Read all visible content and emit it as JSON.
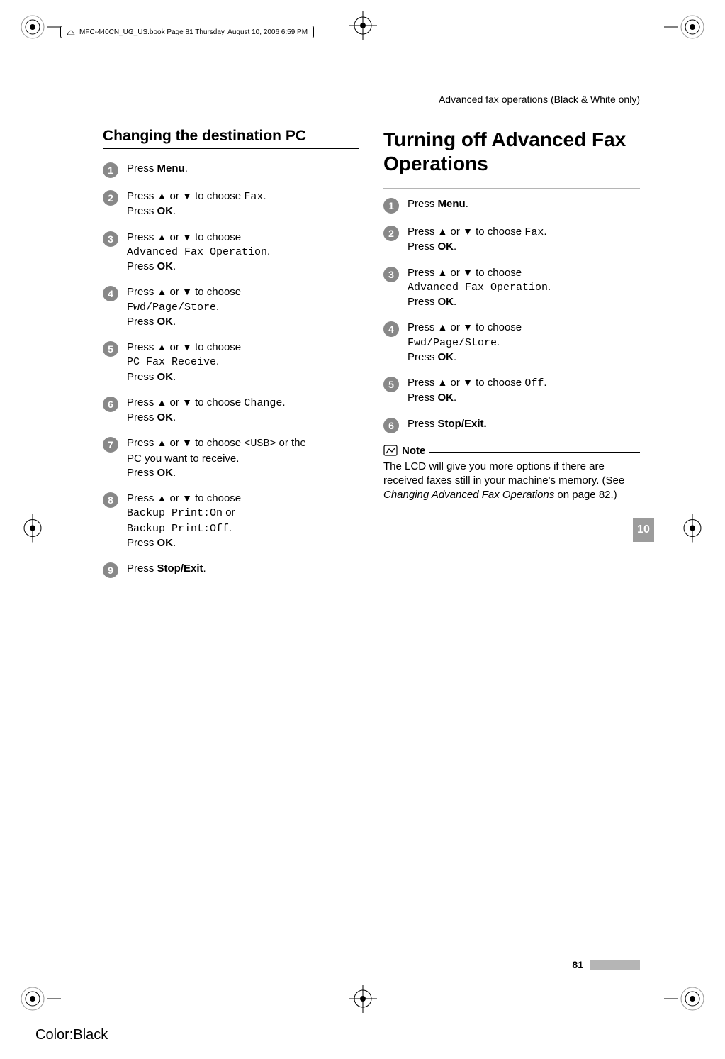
{
  "header": {
    "book_line": "MFC-440CN_UG_US.book  Page 81  Thursday, August 10, 2006  6:59 PM"
  },
  "breadcrumb": "Advanced fax operations (Black & White only)",
  "left_section": {
    "title": "Changing the destination PC",
    "steps": [
      {
        "num": "1",
        "t1": "Press ",
        "b1": "Menu",
        "extra": "."
      },
      {
        "num": "2",
        "t1": "Press ",
        "arw1": "▲",
        "mid": " or ",
        "arw2": "▼",
        "t2": " to choose ",
        "m1": "Fax",
        "t3": ".",
        "line2a": "Press ",
        "line2b": "OK",
        "line2c": "."
      },
      {
        "num": "3",
        "t1": "Press ",
        "arw1": "▲",
        "mid": " or ",
        "arw2": "▼",
        "t2": " to choose",
        "line2mono": "Advanced Fax Operation",
        "line2end": ".",
        "line3a": "Press ",
        "line3b": "OK",
        "line3c": "."
      },
      {
        "num": "4",
        "t1": "Press ",
        "arw1": "▲",
        "mid": " or ",
        "arw2": "▼",
        "t2": " to choose",
        "line2mono": "Fwd/Page/Store",
        "line2end": ".",
        "line3a": "Press ",
        "line3b": "OK",
        "line3c": "."
      },
      {
        "num": "5",
        "t1": "Press ",
        "arw1": "▲",
        "mid": " or ",
        "arw2": "▼",
        "t2": " to choose",
        "line2mono": "PC Fax Receive",
        "line2end": ".",
        "line3a": "Press ",
        "line3b": "OK",
        "line3c": "."
      },
      {
        "num": "6",
        "t1": "Press ",
        "arw1": "▲",
        "mid": " or ",
        "arw2": "▼",
        "t2": " to choose ",
        "m1": "Change",
        "t3": ".",
        "line2a": "Press ",
        "line2b": "OK",
        "line2c": "."
      },
      {
        "num": "7",
        "t1": "Press ",
        "arw1": "▲",
        "mid": " or ",
        "arw2": "▼",
        "t2": " to choose ",
        "m1": "<USB>",
        "t3": " or the",
        "line2plain": "PC you want to receive.",
        "line3a": "Press ",
        "line3b": "OK",
        "line3c": "."
      },
      {
        "num": "8",
        "t1": "Press ",
        "arw1": "▲",
        "mid": " or ",
        "arw2": "▼",
        "t2": " to choose",
        "line2mono": "Backup Print:On",
        "line2end2": " or",
        "line3mono": "Backup Print:Off",
        "line3end": ".",
        "line4a": "Press ",
        "line4b": "OK",
        "line4c": "."
      },
      {
        "num": "9",
        "t1": "Press ",
        "b1": "Stop/Exit",
        "extra": "."
      }
    ]
  },
  "right_section": {
    "title": "Turning off Advanced Fax Operations",
    "steps": [
      {
        "num": "1",
        "t1": "Press ",
        "b1": "Menu",
        "extra": "."
      },
      {
        "num": "2",
        "t1": "Press ",
        "arw1": "▲",
        "mid": " or ",
        "arw2": "▼",
        "t2": " to choose ",
        "m1": "Fax",
        "t3": ".",
        "line2a": "Press ",
        "line2b": "OK",
        "line2c": "."
      },
      {
        "num": "3",
        "t1": "Press ",
        "arw1": "▲",
        "mid": " or ",
        "arw2": "▼",
        "t2": " to choose",
        "line2mono": "Advanced Fax Operation",
        "line2end": ".",
        "line3a": "Press ",
        "line3b": "OK",
        "line3c": "."
      },
      {
        "num": "4",
        "t1": "Press ",
        "arw1": "▲",
        "mid": " or ",
        "arw2": "▼",
        "t2": " to choose",
        "line2mono": "Fwd/Page/Store",
        "line2end": ".",
        "line3a": "Press ",
        "line3b": "OK",
        "line3c": "."
      },
      {
        "num": "5",
        "t1": "Press ",
        "arw1": "▲",
        "mid": " or ",
        "arw2": "▼",
        "t2": " to choose ",
        "m1": "Off",
        "t3": ".",
        "line2a": "Press ",
        "line2b": "OK",
        "line2c": "."
      },
      {
        "num": "6",
        "t1": "Press ",
        "b1": "Stop/Exit.",
        "extra": ""
      }
    ],
    "note_label": "Note",
    "note_body_1": "The LCD will give you more options if there are received faxes still in your machine's memory. (See ",
    "note_body_italic": "Changing Advanced Fax Operations",
    "note_body_2": " on page 82.)"
  },
  "side_tab": "10",
  "page_number": "81",
  "footer_color": "Color:Black"
}
